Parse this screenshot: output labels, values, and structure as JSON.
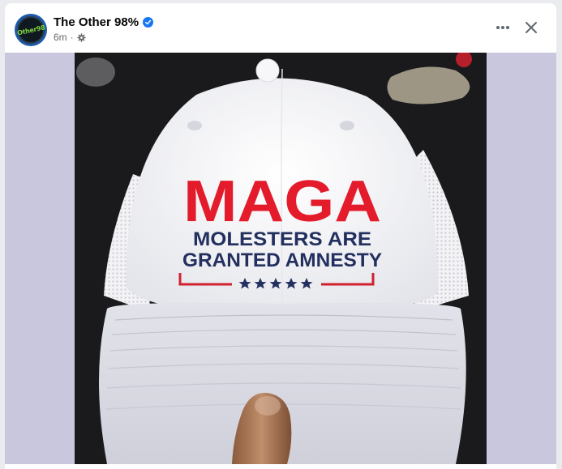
{
  "post": {
    "author": "The Other 98%",
    "avatar_text": "Other98",
    "verified_icon": "verified-badge-icon",
    "timestamp": "6m",
    "separator": "·",
    "audience_icon": "gear-icon",
    "more_icon": "more-options-icon",
    "close_icon": "close-icon"
  },
  "image": {
    "headline": "MAGA",
    "line1": "MOLESTERS ARE",
    "line2": "GRANTED AMNESTY",
    "colors": {
      "headline": "#e31b2a",
      "subtext": "#23305f",
      "stripe": "#d0212e",
      "stars": "#23305f",
      "side_background": "#c8c7de",
      "backdrop": "#1a1a1c"
    }
  }
}
